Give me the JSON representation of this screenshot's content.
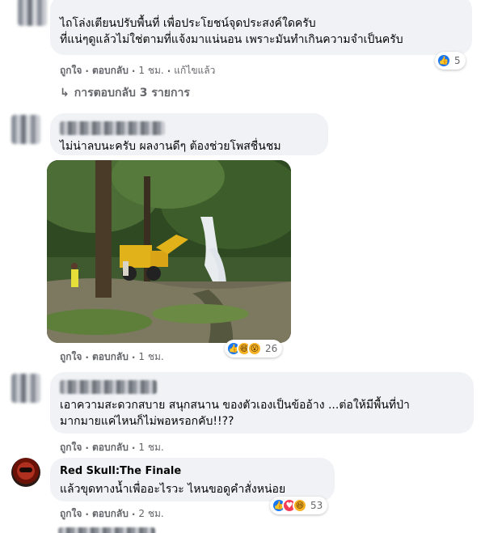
{
  "comments": [
    {
      "text_lines": [
        "ไถโล่งเตียนปรับพื้นที่ เพื่อประโยชน์จุดประสงค์ใดครับ",
        "ที่แน่ๆดูแล้วไม่ใช่ตามที่แจ้งมาแน่นอน เพราะมันทำเกินความจำเป็นครับ"
      ],
      "like": "ถูกใจ",
      "reply": "ตอบกลับ",
      "time": "1 ชม.",
      "edited": "แก้ไขแล้ว",
      "reaction_count": "5",
      "replies_label": "การตอบกลับ 3 รายการ"
    },
    {
      "text_lines": [
        "ไม่น่าลบนะครับ ผลงานดีๆ ต้องช่วยโพสชื่นชม"
      ],
      "like": "ถูกใจ",
      "reply": "ตอบกลับ",
      "time": "1 ชม.",
      "reaction_count": "26"
    },
    {
      "text_lines": [
        "เอาความสะดวกสบาย สนุกสนาน ของตัวเองเป็นข้ออ้าง ...ต่อให้มีพื้นที่ป่า",
        "มากมายแค่ไหนก็ไม่พอหรอกคับ!!??"
      ],
      "like": "ถูกใจ",
      "reply": "ตอบกลับ",
      "time": "1 ชม."
    },
    {
      "author": "Red Skull:The Finale",
      "text_lines": [
        "แล้วขุดทางน้ำเพื่ออะไรวะ ไหนขอดูคำสั่งหน่อย"
      ],
      "like": "ถูกใจ",
      "reply": "ตอบกลับ",
      "time": "2 ชม.",
      "reaction_count": "53"
    }
  ],
  "colors": {
    "bubble": "#f0f2f5",
    "meta": "#65676b",
    "like_blue": "#1877f2"
  }
}
